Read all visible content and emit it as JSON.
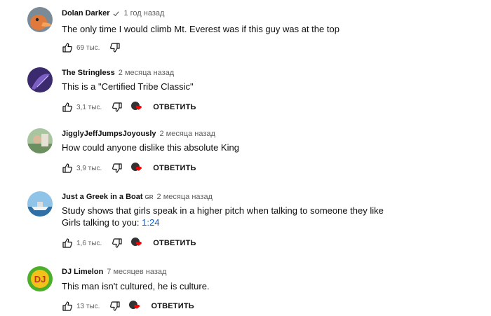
{
  "comments": [
    {
      "author": "Dolan Darker",
      "verified": true,
      "badge": "",
      "time": "1 год назад",
      "lines": [
        "The only time I would climb Mt. Everest was if this guy was at the top"
      ],
      "timestamp": "",
      "likes": "69 тыс.",
      "has_heart": false,
      "reply_label": "",
      "avatar_icon": "duck-avatar"
    },
    {
      "author": "The Stringless",
      "verified": false,
      "badge": "",
      "time": "2 месяца назад",
      "lines": [
        "This is a \"Certified Tribe Classic\""
      ],
      "timestamp": "",
      "likes": "3,1 тыс.",
      "has_heart": true,
      "reply_label": "ОТВЕТИТЬ",
      "avatar_icon": "purple-avatar"
    },
    {
      "author": "JigglyJeffJumpsJoyously",
      "verified": false,
      "badge": "",
      "time": "2 месяца назад",
      "lines": [
        "How could anyone dislike this absolute King"
      ],
      "timestamp": "",
      "likes": "3,9 тыс.",
      "has_heart": true,
      "reply_label": "ОТВЕТИТЬ",
      "avatar_icon": "photo-avatar"
    },
    {
      "author": "Just a Greek in a Boat",
      "verified": false,
      "badge": "GR",
      "time": "2 месяца назад",
      "lines": [
        "Study shows that girls speak in a higher pitch when talking to someone they like",
        "Girls talking to you: "
      ],
      "timestamp": "1:24",
      "likes": "1,6 тыс.",
      "has_heart": true,
      "reply_label": "ОТВЕТИТЬ",
      "avatar_icon": "boat-avatar"
    },
    {
      "author": "DJ Limelon",
      "verified": false,
      "badge": "",
      "time": "7 месяцев назад",
      "lines": [
        "This man isn't cultured, he is culture."
      ],
      "timestamp": "",
      "likes": "13 тыс.",
      "has_heart": true,
      "reply_label": "ОТВЕТИТЬ",
      "avatar_icon": "dj-logo-avatar"
    }
  ]
}
